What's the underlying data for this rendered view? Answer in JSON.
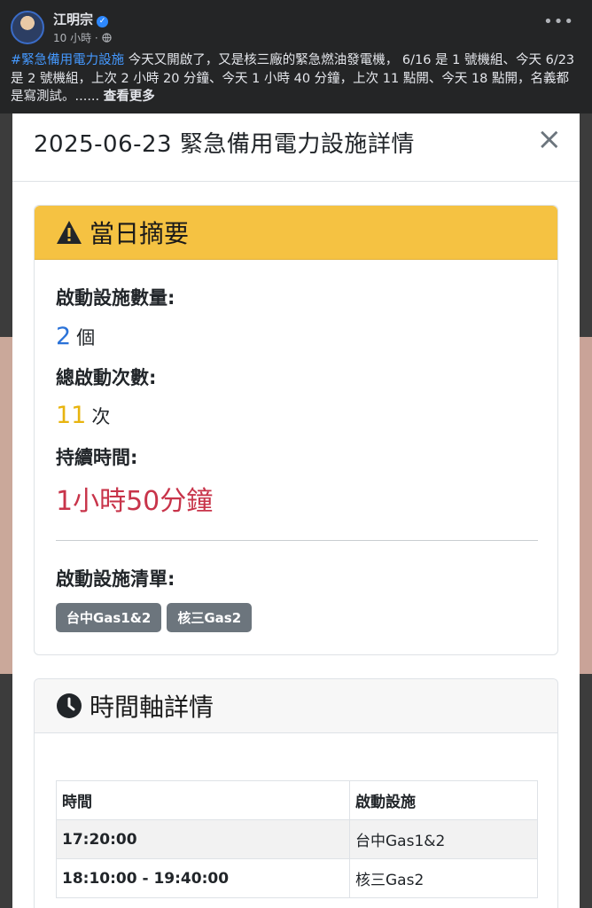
{
  "post": {
    "author": "江明宗",
    "verified_mark": "✓",
    "time": "10 小時",
    "separator": "·",
    "privacy_icon": "globe-icon",
    "more_label": "•••",
    "hashtag": "#緊急備用電力設施",
    "body": " 今天又開啟了，又是核三廠的緊急燃油發電機， 6/16 是 1 號機組、今天 6/23 是 2 號機組，上次 2 小時 20 分鐘、今天 1 小時 40 分鐘，上次 11 點開、今天 18 點開，名義都是寫測試。...... ",
    "see_more": "查看更多"
  },
  "modal": {
    "title": "2025-06-23 緊急備用電力設施詳情",
    "close_label": "×"
  },
  "summary": {
    "heading": "當日摘要",
    "icon": "warning-icon",
    "facility_count_label": "啟動設施數量:",
    "facility_count_value": "2",
    "facility_count_unit": "個",
    "activation_label": "總啟動次數:",
    "activation_value": "11",
    "activation_unit": "次",
    "duration_label": "持續時間:",
    "duration_value": "1小時50分鐘",
    "list_label": "啟動設施清單:",
    "facilities": [
      "台中Gas1&2",
      "核三Gas2"
    ],
    "colors": {
      "header_bg": "#f5c242",
      "count": "#2a72d8",
      "activations": "#e8b40f",
      "duration": "#c8344a"
    }
  },
  "timeline": {
    "heading": "時間軸詳情",
    "icon": "clock-icon",
    "headers": [
      "時間",
      "啟動設施"
    ],
    "rows": [
      [
        "17:20:00",
        "台中Gas1&2"
      ],
      [
        "18:10:00 - 19:40:00",
        "核三Gas2"
      ]
    ]
  }
}
